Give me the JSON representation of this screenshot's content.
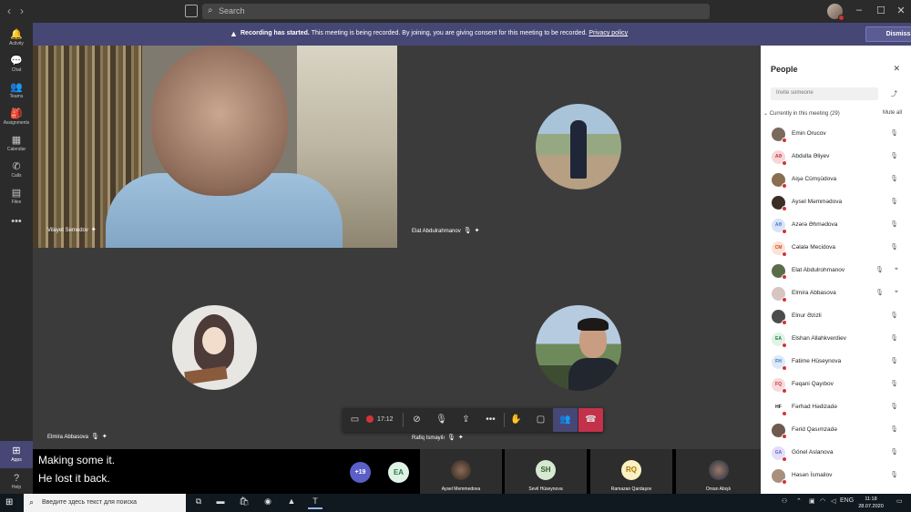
{
  "titlebar": {
    "back_icon": "chevron-left-icon",
    "forward_icon": "chevron-right-icon",
    "search_placeholder": "Search",
    "window_controls": [
      "minimize-icon",
      "maximize-icon",
      "close-icon"
    ]
  },
  "rail": {
    "items": [
      {
        "label": "Activity",
        "icon": "bell-icon",
        "glyph": "🔔"
      },
      {
        "label": "Chat",
        "icon": "chat-icon",
        "glyph": "💬"
      },
      {
        "label": "Teams",
        "icon": "teams-icon",
        "glyph": "👥"
      },
      {
        "label": "Assignments",
        "icon": "assignments-icon",
        "glyph": "🎒"
      },
      {
        "label": "Calendar",
        "icon": "calendar-icon",
        "glyph": "▦"
      },
      {
        "label": "Calls",
        "icon": "phone-icon",
        "glyph": "✆"
      },
      {
        "label": "Files",
        "icon": "files-icon",
        "glyph": "▤"
      }
    ],
    "more": "•••",
    "apps_label": "Apps",
    "help_label": "Help"
  },
  "banner": {
    "bold": "Recording has started.",
    "text": "This meeting is being recorded. By joining, you are giving consent for this meeting to be recorded.",
    "link": "Privacy policy",
    "dismiss": "Dismiss"
  },
  "tiles": {
    "t1_name": "Vilayet Semedov",
    "t2_name": "Elat Abdulrahmanov",
    "t3_name": "Elmira Abbasova",
    "t4_name": "Rafiq Ismayilı"
  },
  "controls": {
    "timer": "17:12"
  },
  "captions": {
    "line1": "Making some it.",
    "line2": "He lost it back."
  },
  "strip": {
    "more": "+19",
    "ea_initials": "EA",
    "tiles": [
      {
        "name": "Aysel Memmedova",
        "initials": ""
      },
      {
        "name": "Sevil Hüseynova",
        "initials": "SH"
      },
      {
        "name": "Ramazan Qardaşov",
        "initials": "RQ"
      },
      {
        "name": "Orxan Abışlı",
        "initials": ""
      }
    ]
  },
  "panel": {
    "title": "People",
    "invite_placeholder": "Invite someone",
    "section": "Currently in this meeting (29)",
    "mute_all": "Mute all",
    "people": [
      {
        "name": "Emin Orucov",
        "initials": "",
        "bg": "#7a6a5c",
        "fg": "#fff",
        "camera": false
      },
      {
        "name": "Abdulla Əliyev",
        "initials": "AƏ",
        "bg": "#f7d7d5",
        "fg": "#c4314b",
        "camera": false
      },
      {
        "name": "Aişə Cümşüdova",
        "initials": "",
        "bg": "#8a6e50",
        "fg": "#fff",
        "camera": false
      },
      {
        "name": "Aysel Məmmədova",
        "initials": "",
        "bg": "#3b2e26",
        "fg": "#fff",
        "camera": false
      },
      {
        "name": "Azərə Əhmədova",
        "initials": "AƏ",
        "bg": "#d9e4f5",
        "fg": "#4f6bed",
        "camera": false
      },
      {
        "name": "Cəlalə Mecidova",
        "initials": "CM",
        "bg": "#fde1d6",
        "fg": "#ca5010",
        "camera": false
      },
      {
        "name": "Elat Abdulrohmanov",
        "initials": "",
        "bg": "#5c6b48",
        "fg": "#fff",
        "camera": true
      },
      {
        "name": "Elmira Abbasova",
        "initials": "",
        "bg": "#d8c4c0",
        "fg": "#fff",
        "camera": true
      },
      {
        "name": "Elnur Əzizli",
        "initials": "",
        "bg": "#4c4c4c",
        "fg": "#fff",
        "camera": false
      },
      {
        "name": "Elshan Allahkverdiev",
        "initials": "EA",
        "bg": "#dff3e4",
        "fg": "#237b4b",
        "camera": false
      },
      {
        "name": "Fatime Hüseynova",
        "initials": "FH",
        "bg": "#dde9f7",
        "fg": "#2f6cc4",
        "camera": false
      },
      {
        "name": "Fəqani Qayıbov",
        "initials": "FQ",
        "bg": "#f8d9d9",
        "fg": "#c4314b",
        "camera": false
      },
      {
        "name": "Fərhad Hədizadə",
        "initials": "HF",
        "bg": "#ffffff",
        "fg": "#111",
        "camera": false
      },
      {
        "name": "Fərid Qasımzadə",
        "initials": "",
        "bg": "#6e5a4e",
        "fg": "#fff",
        "camera": false
      },
      {
        "name": "Gönel Aslanova",
        "initials": "GA",
        "bg": "#e3defa",
        "fg": "#6b5fc7",
        "camera": false
      },
      {
        "name": "Həsən İsmailov",
        "initials": "",
        "bg": "#a88f7e",
        "fg": "#fff",
        "camera": false
      }
    ]
  },
  "taskbar": {
    "search_placeholder": "Введите здесь текст для поиска",
    "lang": "ENG",
    "time": "11:18",
    "date": "28.07.2020"
  }
}
